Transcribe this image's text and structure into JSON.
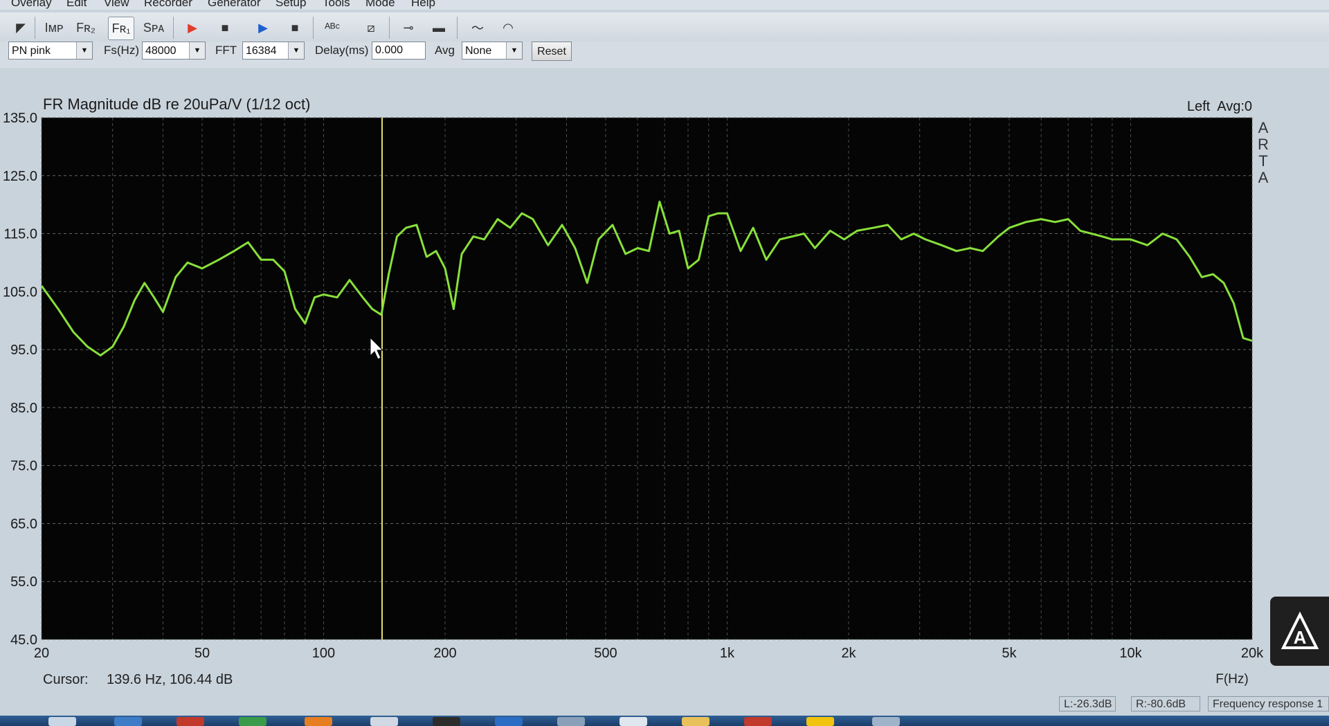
{
  "menu": [
    "Overlay",
    "Edit",
    "View",
    "Recorder",
    "Generator",
    "Setup",
    "Tools",
    "Mode",
    "Help"
  ],
  "toolbar": {
    "buttons": [
      {
        "name": "open-icon",
        "glyph": "◤"
      },
      {
        "name": "imp-mode-button",
        "glyph": "Iᴍᴘ"
      },
      {
        "name": "fr2-mode-button",
        "glyph": "Fʀ₂"
      },
      {
        "name": "fr1-mode-button",
        "glyph": "Fʀ₁",
        "active": true
      },
      {
        "name": "spa-mode-button",
        "glyph": "Sᴘᴀ"
      },
      {
        "name": "record-play-icon",
        "glyph": "▶",
        "color": "#e23c2c"
      },
      {
        "name": "record-stop-icon",
        "glyph": "■",
        "color": "#333333"
      },
      {
        "name": "generator-play-icon",
        "glyph": "▶",
        "color": "#1f5fcf"
      },
      {
        "name": "generator-stop-icon",
        "glyph": "■",
        "color": "#333333"
      },
      {
        "name": "abc-icon",
        "glyph": "ᴬᴮᶜ"
      },
      {
        "name": "waveform-icon",
        "glyph": "⧄"
      },
      {
        "name": "probe-icon",
        "glyph": "⊸"
      },
      {
        "name": "spectrum-icon",
        "glyph": "▬"
      },
      {
        "name": "scope-icon",
        "glyph": "〜"
      },
      {
        "name": "meter-icon",
        "glyph": "◠"
      }
    ]
  },
  "controls": {
    "generator_value": "PN pink",
    "fs_label": "Fs(Hz)",
    "fs_value": "48000",
    "fft_label": "FFT",
    "fft_value": "16384",
    "delay_label": "Delay(ms)",
    "delay_value": "0.000",
    "avg_label": "Avg",
    "avg_value": "None",
    "reset_label": "Reset"
  },
  "graph": {
    "title": "FR Magnitude dB re 20uPa/V (1/12 oct)",
    "channel_info": "Left  Avg:0",
    "brand_letters": [
      "A",
      "R",
      "T",
      "A"
    ],
    "cursor_label": "Cursor:",
    "cursor_value": "139.6 Hz, 106.44 dB",
    "background": "#050505",
    "grid_color": "#5f6b5f",
    "curve_color": "#88e03a",
    "cursor_color": "#e6e070"
  },
  "chart_data": {
    "type": "line",
    "title": "FR Magnitude dB re 20uPa/V (1/12 oct)",
    "xlabel": "F(Hz)",
    "ylabel": "",
    "xscale": "log",
    "xlim": [
      20,
      20000
    ],
    "ylim": [
      45,
      135
    ],
    "y_ticks": [
      "135.0",
      "125.0",
      "115.0",
      "105.0",
      "95.0",
      "85.0",
      "75.0",
      "65.0",
      "55.0",
      "45.0"
    ],
    "x_ticks": [
      {
        "value": 20,
        "label": "20"
      },
      {
        "value": 50,
        "label": "50"
      },
      {
        "value": 100,
        "label": "100"
      },
      {
        "value": 200,
        "label": "200"
      },
      {
        "value": 500,
        "label": "500"
      },
      {
        "value": 1000,
        "label": "1k"
      },
      {
        "value": 2000,
        "label": "2k"
      },
      {
        "value": 5000,
        "label": "5k"
      },
      {
        "value": 10000,
        "label": "10k"
      },
      {
        "value": 20000,
        "label": "20k"
      }
    ],
    "grid": true,
    "cursor_x": 139.6,
    "series": [
      {
        "x": [
          20,
          22,
          24,
          26,
          28,
          30,
          32,
          34,
          36,
          38,
          40,
          43,
          46,
          50,
          55,
          60,
          65,
          70,
          75,
          80,
          85,
          90,
          95,
          100,
          108,
          116,
          125,
          132,
          139,
          145,
          152,
          160,
          170,
          180,
          190,
          200,
          210,
          220,
          235,
          250,
          270,
          290,
          310,
          330,
          360,
          390,
          420,
          450,
          480,
          520,
          560,
          600,
          640,
          680,
          720,
          760,
          800,
          850,
          900,
          950,
          1000,
          1080,
          1160,
          1250,
          1350,
          1450,
          1550,
          1650,
          1800,
          1950,
          2100,
          2300,
          2500,
          2700,
          2900,
          3100,
          3400,
          3700,
          4000,
          4300,
          4700,
          5000,
          5500,
          6000,
          6500,
          7000,
          7500,
          8000,
          8500,
          9000,
          10000,
          11000,
          12000,
          13000,
          14000,
          15000,
          16000,
          17000,
          18000,
          19000,
          20000
        ],
        "y": [
          106,
          102,
          98,
          95.5,
          94,
          95.5,
          99,
          103.5,
          106.5,
          104,
          101.5,
          107.5,
          110,
          109,
          110.5,
          112,
          113.5,
          110.5,
          110.5,
          108.5,
          102,
          99.5,
          104,
          104.5,
          104,
          107,
          104,
          102,
          101,
          108,
          114.5,
          116,
          116.5,
          111,
          112,
          109,
          102,
          111.5,
          114.5,
          114,
          117.5,
          116,
          118.5,
          117.5,
          113,
          116.5,
          112.5,
          106.5,
          114,
          116.5,
          111.5,
          112.5,
          112,
          120.5,
          115,
          115.5,
          109,
          110.5,
          118,
          118.5,
          118.5,
          112,
          116,
          110.5,
          114,
          114.5,
          115,
          112.5,
          115.5,
          114,
          115.5,
          116,
          116.5,
          114,
          115,
          114,
          113,
          112,
          112.5,
          112,
          114.5,
          116,
          117,
          117.5,
          117,
          117.5,
          115.5,
          115,
          114.5,
          114,
          114,
          113,
          115,
          114,
          111,
          107.5,
          108,
          106.5,
          103,
          97,
          96.5
        ]
      }
    ]
  },
  "status": {
    "l_level": "L:-26.3dB",
    "r_level": "R:-80.6dB",
    "mode_text": "Frequency response 1"
  },
  "taskbar_colors": [
    "#c9d6e6",
    "#3f7cc8",
    "#c0392b",
    "#3a9b4b",
    "#e67e22",
    "#cfd8e3",
    "#2c2c2c",
    "#2b6cc4",
    "#8aa0b8",
    "#dfe6ee",
    "#e8c15a",
    "#c0392b",
    "#f1c40f",
    "#9fb3c9"
  ]
}
